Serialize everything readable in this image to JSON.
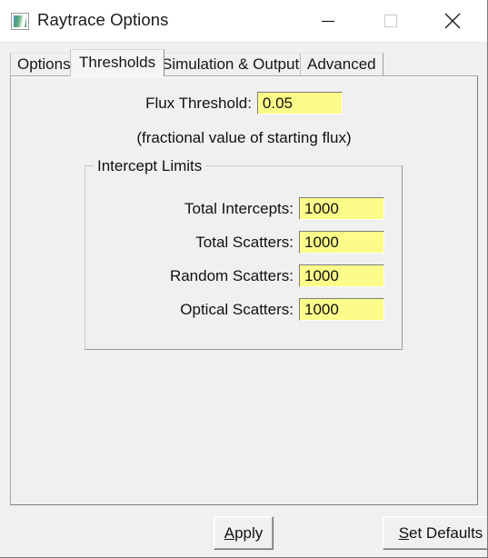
{
  "window": {
    "title": "Raytrace Options",
    "icon": "image-preview-icon",
    "controls": {
      "minimize": "minimize-icon",
      "maximize": "maximize-icon",
      "close": "close-icon"
    }
  },
  "tabs": [
    {
      "label": "Options",
      "selected": false
    },
    {
      "label": "Thresholds",
      "selected": true
    },
    {
      "label": "Simulation & Output",
      "selected": false
    },
    {
      "label": "Advanced",
      "selected": false
    }
  ],
  "panel": {
    "flux": {
      "label": "Flux Threshold:",
      "value": "0.05",
      "placeholder": "",
      "hint": "(fractional value of starting flux)"
    },
    "intercept_limits": {
      "legend": "Intercept Limits",
      "rows": [
        {
          "label": "Total Intercepts:",
          "value": "1000",
          "placeholder": ""
        },
        {
          "label": "Total Scatters:",
          "value": "1000",
          "placeholder": ""
        },
        {
          "label": "Random Scatters:",
          "value": "1000",
          "placeholder": ""
        },
        {
          "label": "Optical Scatters:",
          "value": "1000",
          "placeholder": ""
        }
      ]
    }
  },
  "buttons": {
    "apply": {
      "mnemonic": "A",
      "rest": "pply"
    },
    "set_defaults": {
      "mnemonic": "S",
      "rest": "et Defaults"
    }
  },
  "colors": {
    "field_background": "#fcfc8a",
    "window_background": "#f0f0f0",
    "titlebar_background": "#ffffff",
    "text": "#111111"
  }
}
